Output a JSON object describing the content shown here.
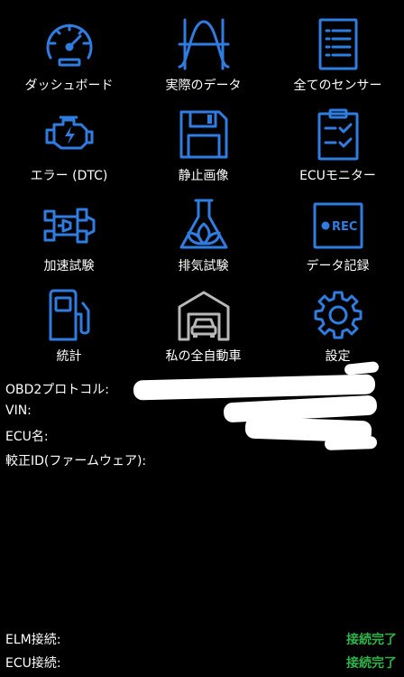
{
  "menu": {
    "items": [
      {
        "label": "ダッシュボード",
        "icon": "speedometer-icon"
      },
      {
        "label": "実際のデータ",
        "icon": "sine-wave-icon"
      },
      {
        "label": "全てのセンサー",
        "icon": "list-document-icon"
      },
      {
        "label": "エラー (DTC)",
        "icon": "engine-warning-icon"
      },
      {
        "label": "静止画像",
        "icon": "floppy-disk-icon"
      },
      {
        "label": "ECUモニター",
        "icon": "clipboard-check-icon"
      },
      {
        "label": "加速試験",
        "icon": "race-car-icon"
      },
      {
        "label": "排気試験",
        "icon": "flask-leaf-icon"
      },
      {
        "label": "データ記録",
        "icon": "rec-icon"
      },
      {
        "label": "統計",
        "icon": "fuel-pump-icon"
      },
      {
        "label": "私の全自動車",
        "icon": "garage-car-icon"
      },
      {
        "label": "設定",
        "icon": "gear-icon"
      }
    ],
    "rec_text": "REC"
  },
  "info": {
    "protocol_label": "OBD2プロトコル:",
    "vin_label": "VIN:",
    "ecu_name_label": "ECU名:",
    "firmware_label": "較正ID(ファームウェア):"
  },
  "status": {
    "elm_label": "ELM接続:",
    "elm_value": "接続完了",
    "ecu_label": "ECU接続:",
    "ecu_value": "接続完了"
  },
  "colors": {
    "icon_blue": "#2f7de0",
    "icon_gray": "#b8b8b8",
    "status_green": "#2fb34a",
    "background": "#000000"
  }
}
